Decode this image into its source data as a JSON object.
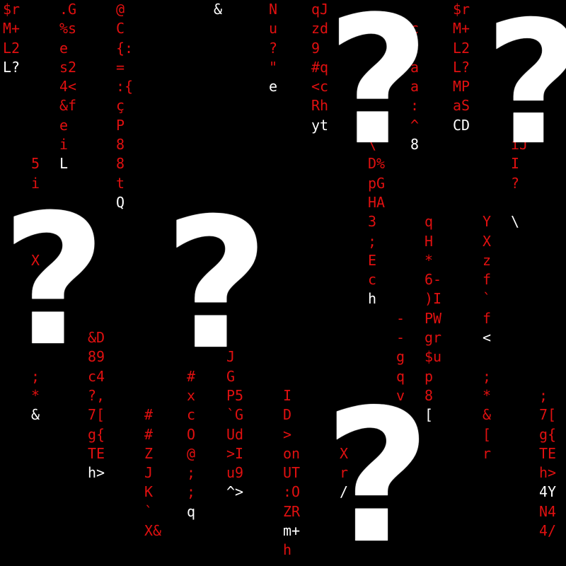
{
  "colors": {
    "background": "#000000",
    "trail": "#e01010",
    "head": "#ffffff",
    "question_mark": "#ffffff"
  },
  "question_mark_glyph": "?",
  "columns": [
    {
      "chars": [
        "$r",
        "M+",
        "L2",
        "L?"
      ],
      "head_index": 3
    },
    {
      "chars": [
        "",
        "",
        "",
        "",
        "",
        "",
        "",
        "",
        "5",
        "i",
        "",
        "",
        "",
        "X",
        "",
        "",
        "",
        "5",
        "",
        ";",
        "*",
        "&"
      ],
      "head_index": 21
    },
    {
      "chars": [
        ".G",
        "%s",
        "e",
        "s2",
        "4<",
        "&f",
        "e",
        "i",
        "L"
      ],
      "head_index": 8
    },
    {
      "chars": [
        "",
        "",
        "",
        "",
        "",
        "",
        "",
        "",
        "",
        "",
        "",
        "",
        "",
        "",
        "",
        "",
        "",
        "&D",
        "89",
        "c4",
        "?,",
        "7[",
        "g{",
        "TE",
        "h>"
      ],
      "head_index": 24
    },
    {
      "chars": [
        "@",
        "C",
        "{:",
        "=",
        ":{",
        "ç",
        "P",
        "8",
        "8",
        "t",
        "Q"
      ],
      "head_index": 10
    },
    {
      "chars": [
        "",
        "",
        "",
        "",
        "",
        "",
        "",
        "",
        "",
        "",
        "",
        "",
        "",
        "",
        "",
        "",
        "",
        "",
        "",
        "",
        "",
        "#",
        "#",
        "Z",
        "J",
        "K",
        "`",
        "X&"
      ],
      "head_index": -1
    },
    {
      "chars": [
        "",
        "",
        "",
        "",
        "",
        "",
        "",
        "",
        "",
        "",
        "",
        "",
        "",
        "",
        "",
        "",
        "",
        "",
        "",
        "#",
        "x",
        "c",
        "O",
        "@",
        ";",
        ";",
        "q"
      ],
      "head_index": 26
    },
    {
      "chars": [
        "&"
      ],
      "head_index": 0
    },
    {
      "chars": [
        "",
        "",
        "",
        "",
        "",
        "",
        "",
        "",
        "",
        "",
        "",
        "",
        "",
        "",
        "",
        "",
        "",
        "",
        "J",
        "G",
        "P5",
        "`G",
        "Ud",
        ">I",
        "u9",
        "^>"
      ],
      "head_index": 25
    },
    {
      "chars": [
        "N",
        "u",
        "?",
        "\"",
        "e"
      ],
      "head_index": 4
    },
    {
      "chars": [
        "",
        "",
        "",
        "",
        "",
        "",
        "",
        "",
        "",
        "",
        "",
        "",
        "",
        "",
        "",
        "",
        "",
        "",
        "",
        "",
        "I",
        "D",
        ">",
        "on",
        "UT",
        ":O",
        "ZR",
        "m+",
        "h"
      ],
      "head_index": 27
    },
    {
      "chars": [
        "qJ",
        "zd",
        "9",
        "#q",
        "<c",
        "Rh",
        "yt"
      ],
      "head_index": 6
    },
    {
      "chars": [
        "",
        "",
        "",
        "",
        "",
        "",
        "",
        "",
        "",
        "",
        "",
        "",
        "",
        "",
        "",
        "",
        "",
        "",
        "",
        "",
        "",
        "",
        "",
        "X",
        "r",
        "/"
      ],
      "head_index": 25
    },
    {
      "chars": [
        "",
        "",
        "",
        "",
        "",
        "",
        "",
        "\\",
        "D%",
        "pG",
        "HA",
        "3",
        ";",
        "E",
        "c",
        "h"
      ],
      "head_index": 15
    },
    {
      "chars": [
        "",
        "c",
        "v",
        "a",
        "a",
        ":",
        "^",
        "8"
      ],
      "head_index": 7
    },
    {
      "chars": [
        "",
        "",
        "",
        "",
        "",
        "",
        "",
        "",
        "",
        "",
        "",
        "",
        "",
        "",
        "",
        "",
        "-",
        "-",
        "g",
        "q",
        "v",
        "h",
        "2",
        "6"
      ],
      "head_index": 23
    },
    {
      "chars": [
        "",
        "",
        "",
        "",
        "",
        "",
        "",
        "",
        "",
        "",
        "",
        "q",
        "H",
        "*",
        "6-",
        ")I",
        "PW",
        "gr",
        "$u",
        "p",
        "8",
        "["
      ],
      "head_index": 21
    },
    {
      "chars": [
        "$r",
        "M+",
        "L2",
        "L?",
        "MP",
        "aS",
        "CD"
      ],
      "head_index": 6
    },
    {
      "chars": [
        "",
        "",
        "",
        "",
        "",
        "",
        "",
        "",
        "",
        "",
        "",
        "Y",
        "X",
        "z",
        "f",
        "`",
        "f",
        "<",
        "",
        ";",
        "*",
        "&",
        "[",
        "r"
      ],
      "head_index": 17
    },
    {
      "chars": [
        "",
        "",
        "",
        "",
        "",
        "",
        "",
        "iJ",
        "I",
        "?",
        "",
        "\\"
      ],
      "head_index": 11
    },
    {
      "chars": [
        "",
        "",
        "",
        "",
        "",
        "",
        "",
        "",
        "",
        "",
        "",
        "",
        "",
        "",
        "",
        "",
        "",
        "",
        "",
        "",
        ";",
        "7[",
        "g{",
        "TE",
        "h>",
        "4Y",
        "N4",
        "4/"
      ],
      "head_index": 25
    }
  ]
}
